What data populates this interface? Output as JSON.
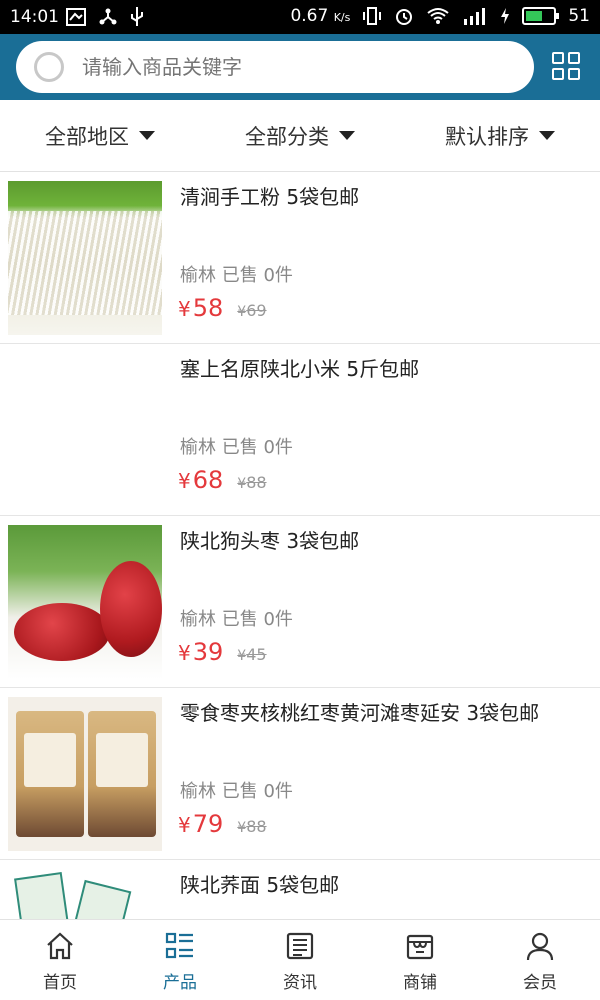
{
  "status_bar": {
    "time": "14:01",
    "net_speed": "0.67",
    "net_unit": "K/s",
    "battery": "51"
  },
  "header": {
    "search_placeholder": "请输入商品关键字"
  },
  "filters": [
    {
      "label": "全部地区"
    },
    {
      "label": "全部分类"
    },
    {
      "label": "默认排序"
    }
  ],
  "products": [
    {
      "title": "清涧手工粉 5袋包邮",
      "location": "榆林",
      "sold": "已售 0件",
      "price": "58",
      "old_price": "69",
      "currency": "¥"
    },
    {
      "title": "塞上名原陕北小米 5斤包邮",
      "location": "榆林",
      "sold": "已售 0件",
      "price": "68",
      "old_price": "88",
      "currency": "¥"
    },
    {
      "title": "陕北狗头枣 3袋包邮",
      "location": "榆林",
      "sold": "已售 0件",
      "price": "39",
      "old_price": "45",
      "currency": "¥"
    },
    {
      "title": "零食枣夹核桃红枣黄河滩枣延安 3袋包邮",
      "location": "榆林",
      "sold": "已售 0件",
      "price": "79",
      "old_price": "88",
      "currency": "¥"
    },
    {
      "title": "陕北荞面 5袋包邮",
      "location": "",
      "sold": "",
      "price": "",
      "old_price": "",
      "currency": ""
    }
  ],
  "bottom_nav": [
    {
      "label": "首页",
      "icon": "home-icon",
      "active": false
    },
    {
      "label": "产品",
      "icon": "list-icon",
      "active": true
    },
    {
      "label": "资讯",
      "icon": "news-icon",
      "active": false
    },
    {
      "label": "商铺",
      "icon": "shop-icon",
      "active": false
    },
    {
      "label": "会员",
      "icon": "user-icon",
      "active": false
    }
  ],
  "colors": {
    "header_bg": "#1a6e96",
    "price": "#e4393c",
    "active_tab": "#1a6e96"
  }
}
